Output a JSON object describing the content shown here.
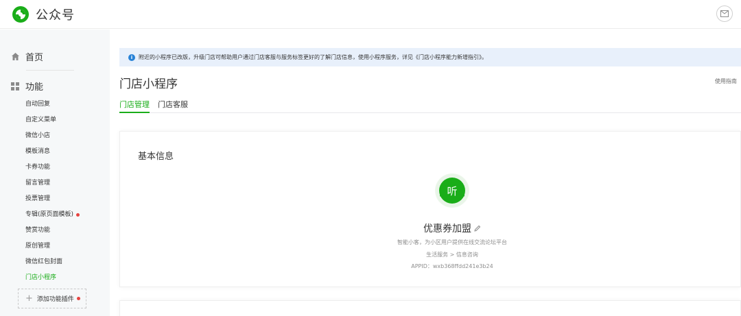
{
  "header": {
    "logo_text": "公众号",
    "brand_color": "#1aad19"
  },
  "sidebar": {
    "home_label": "首页",
    "function_label": "功能",
    "items": [
      {
        "label": "自动回复"
      },
      {
        "label": "自定义菜单"
      },
      {
        "label": "微信小店"
      },
      {
        "label": "模板消息"
      },
      {
        "label": "卡券功能"
      },
      {
        "label": "留言管理"
      },
      {
        "label": "投票管理"
      },
      {
        "label": "专辑(原页面模板)"
      },
      {
        "label": "赞赏功能"
      },
      {
        "label": "原创管理"
      },
      {
        "label": "微信红包封面"
      },
      {
        "label": "门店小程序"
      }
    ],
    "add_plugin_label": "添加功能插件"
  },
  "main": {
    "notice": "附近的小程序已改版，升级门店可帮助用户通过门店客服与服务标签更好的了解门店信息，使用小程序服务，详见《门店小程序能力新增指引》。",
    "page_title": "门店小程序",
    "guide_link": "使用指南",
    "tabs": [
      {
        "label": "门店管理"
      },
      {
        "label": "门店客服"
      }
    ],
    "basic_info": {
      "section_title": "基本信息",
      "logo_char": "听",
      "app_name": "优惠券加盟",
      "description": "智能小客，为小区用户提供在线交流论坛平台",
      "category": "生活服务 > 信息咨询",
      "appid": "APPID：wxb368ffdd241e3b24"
    }
  }
}
